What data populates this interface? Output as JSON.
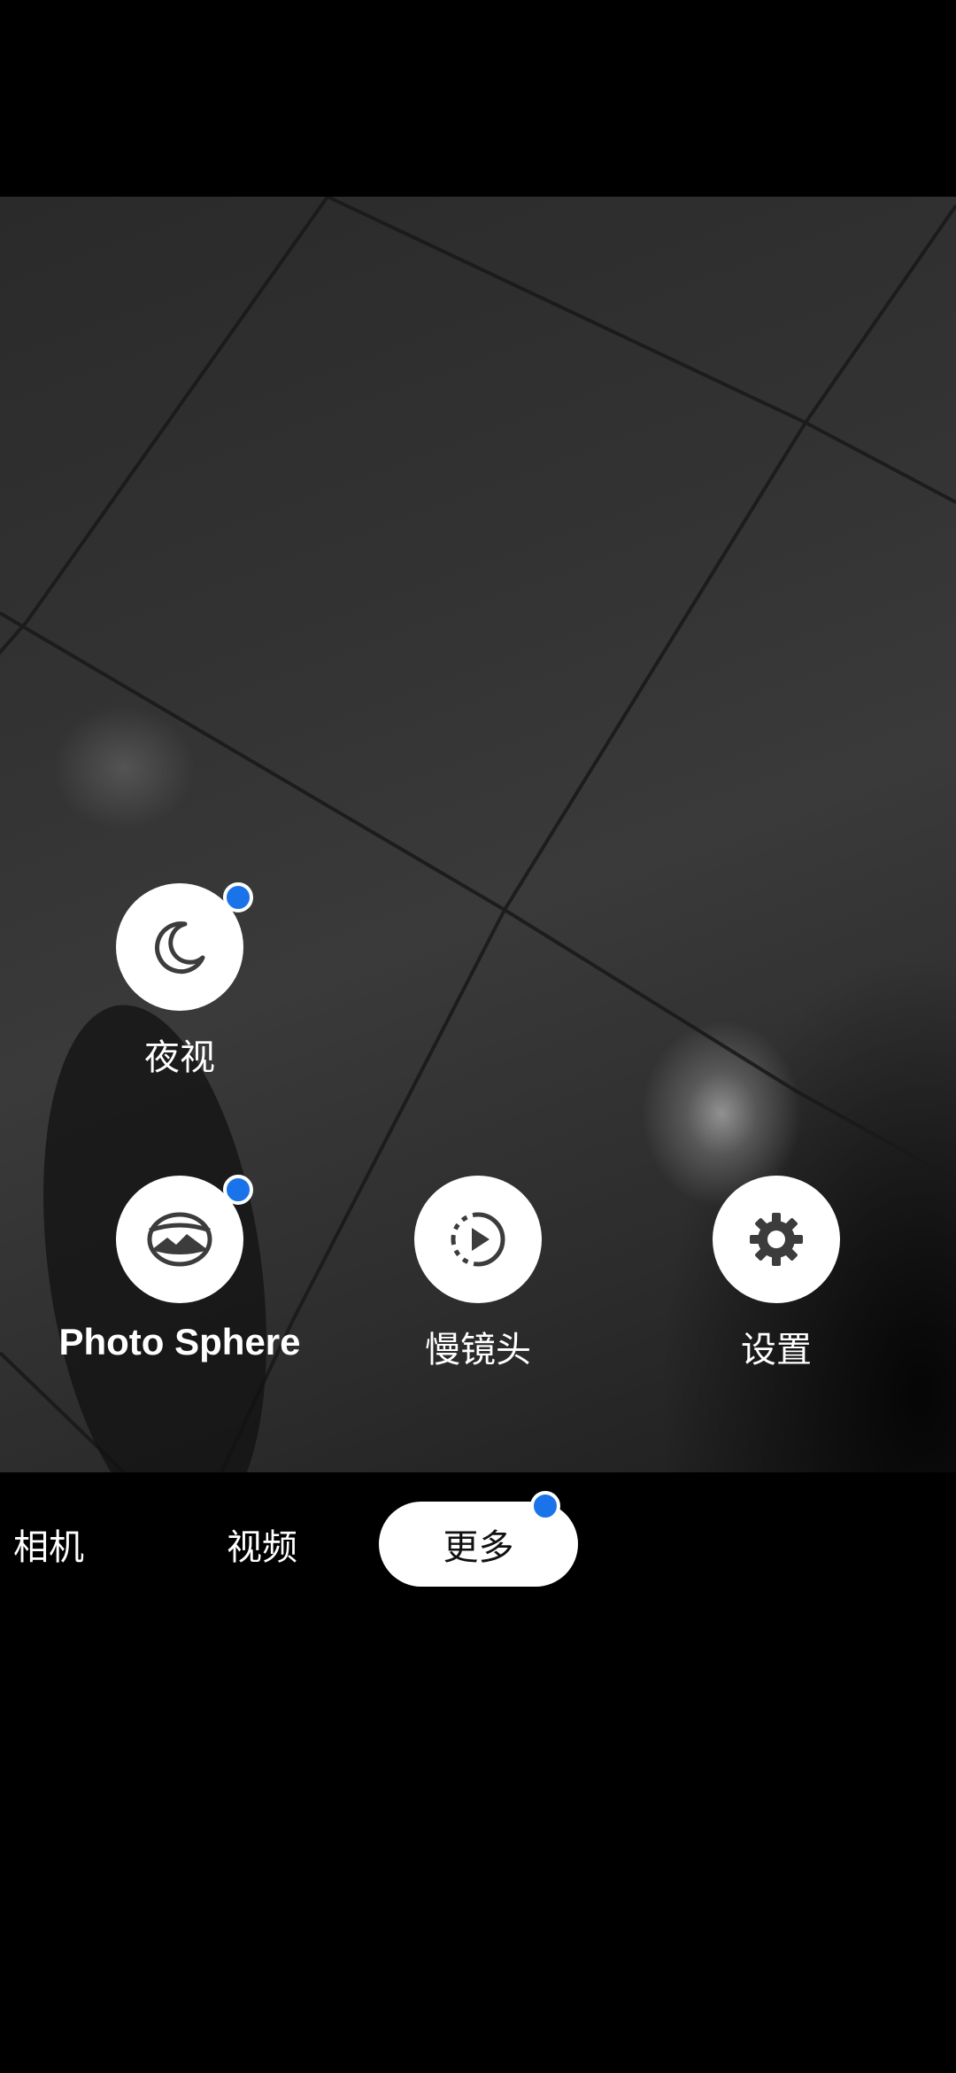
{
  "modes": {
    "night_sight": {
      "label": "夜视",
      "icon": "moon-icon",
      "has_badge": true
    },
    "photo_sphere": {
      "label": "Photo Sphere",
      "icon": "photo-sphere-icon",
      "has_badge": true
    },
    "slow_motion": {
      "label": "慢镜头",
      "icon": "slow-motion-icon",
      "has_badge": false
    },
    "settings": {
      "label": "设置",
      "icon": "gear-icon",
      "has_badge": false
    }
  },
  "tabs": [
    {
      "label": "相机",
      "active": false
    },
    {
      "label": "视频",
      "active": false
    },
    {
      "label": "更多",
      "active": true,
      "has_badge": true
    }
  ],
  "colors": {
    "badge": "#1a73e8",
    "active_tab_bg": "#ffffff",
    "icon": "#3c3c3c"
  }
}
